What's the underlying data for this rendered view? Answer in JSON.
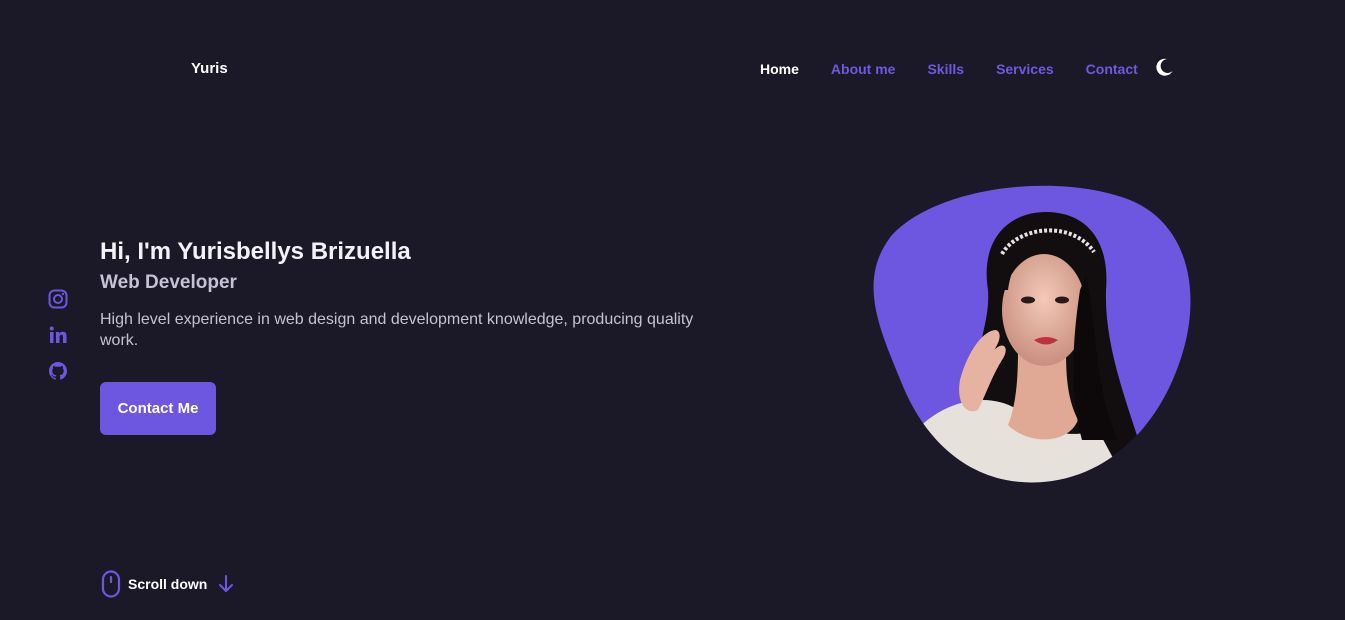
{
  "header": {
    "logo": "Yuris",
    "nav": [
      {
        "label": "Home",
        "active": true
      },
      {
        "label": "About me",
        "active": false
      },
      {
        "label": "Skills",
        "active": false
      },
      {
        "label": "Services",
        "active": false
      },
      {
        "label": "Contact",
        "active": false
      }
    ],
    "theme_toggle_icon": "moon-icon"
  },
  "socials": [
    {
      "icon": "instagram-icon"
    },
    {
      "icon": "linkedin-icon"
    },
    {
      "icon": "github-icon"
    }
  ],
  "hero": {
    "title": "Hi, I'm Yurisbellys Brizuella",
    "subtitle": "Web Developer",
    "description": "High level experience in web design and development knowledge, producing quality work.",
    "cta_label": "Contact Me",
    "image_icon": "profile-photo"
  },
  "scroll": {
    "label": "Scroll down",
    "mouse_icon": "mouse-icon",
    "arrow_icon": "arrow-down-icon"
  },
  "colors": {
    "background": "#1b1827",
    "accent": "#6d56e0",
    "text_primary": "#ffffff",
    "text_secondary": "#c5c2d6"
  }
}
